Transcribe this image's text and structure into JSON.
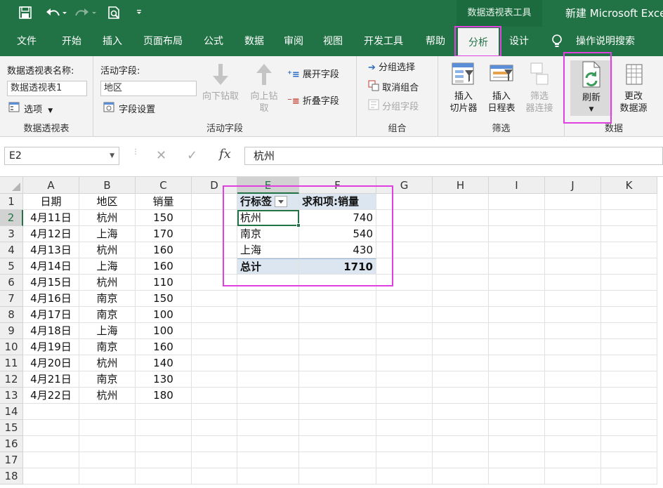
{
  "title_bar": {
    "context_header": "数据透视表工具",
    "doc_title": "新建 Microsoft Exce"
  },
  "tabs": [
    {
      "label": "文件"
    },
    {
      "label": "开始"
    },
    {
      "label": "插入"
    },
    {
      "label": "页面布局"
    },
    {
      "label": "公式"
    },
    {
      "label": "数据"
    },
    {
      "label": "审阅"
    },
    {
      "label": "视图"
    },
    {
      "label": "开发工具"
    },
    {
      "label": "帮助"
    },
    {
      "label": "分析"
    },
    {
      "label": "设计"
    }
  ],
  "tell_me": "操作说明搜索",
  "ribbon": {
    "pivot": {
      "name_label": "数据透视表名称:",
      "name_value": "数据透视表1",
      "options": "选项",
      "group": "数据透视表"
    },
    "active_field": {
      "label": "活动字段:",
      "value": "地区",
      "field_settings": "字段设置",
      "drill_down": "向下钻取",
      "drill_up_1": "向上钻",
      "drill_up_2": "取",
      "expand": "展开字段",
      "collapse": "折叠字段",
      "group": "活动字段"
    },
    "grouping": {
      "group_selection": "分组选择",
      "ungroup": "取消组合",
      "group_field": "分组字段",
      "group": "组合"
    },
    "filter": {
      "slicer_1": "插入",
      "slicer_2": "切片器",
      "timeline_1": "插入",
      "timeline_2": "日程表",
      "connections_1": "筛选",
      "connections_2": "器连接",
      "group": "筛选"
    },
    "data": {
      "refresh": "刷新",
      "change_source_1": "更改",
      "change_source_2": "数据源",
      "group": "数据"
    }
  },
  "formula_bar": {
    "name_box": "E2",
    "cancel": "✕",
    "enter": "✓",
    "fx": "fx",
    "content": "杭州"
  },
  "columns": [
    "A",
    "B",
    "C",
    "D",
    "E",
    "F",
    "G",
    "H",
    "I",
    "J",
    "K"
  ],
  "rows": [
    "1",
    "2",
    "3",
    "4",
    "5",
    "6",
    "7",
    "8",
    "9",
    "10",
    "11",
    "12",
    "13",
    "14",
    "15",
    "16",
    "17",
    "18"
  ],
  "table": {
    "headers": [
      "日期",
      "地区",
      "销量"
    ],
    "records": [
      [
        "4月11日",
        "杭州",
        "150"
      ],
      [
        "4月12日",
        "上海",
        "170"
      ],
      [
        "4月13日",
        "杭州",
        "160"
      ],
      [
        "4月14日",
        "上海",
        "160"
      ],
      [
        "4月15日",
        "杭州",
        "110"
      ],
      [
        "4月16日",
        "南京",
        "150"
      ],
      [
        "4月17日",
        "南京",
        "100"
      ],
      [
        "4月18日",
        "上海",
        "100"
      ],
      [
        "4月19日",
        "南京",
        "160"
      ],
      [
        "4月20日",
        "杭州",
        "140"
      ],
      [
        "4月21日",
        "南京",
        "130"
      ],
      [
        "4月22日",
        "杭州",
        "180"
      ]
    ]
  },
  "pivot_table": {
    "row_label": "行标签",
    "value_label": "求和项:销量",
    "rows": [
      [
        "杭州",
        "740"
      ],
      [
        "南京",
        "540"
      ],
      [
        "上海",
        "430"
      ]
    ],
    "total_label": "总计",
    "total_value": "1710"
  },
  "highlight_color": "#e040e0",
  "accent_color": "#217346"
}
